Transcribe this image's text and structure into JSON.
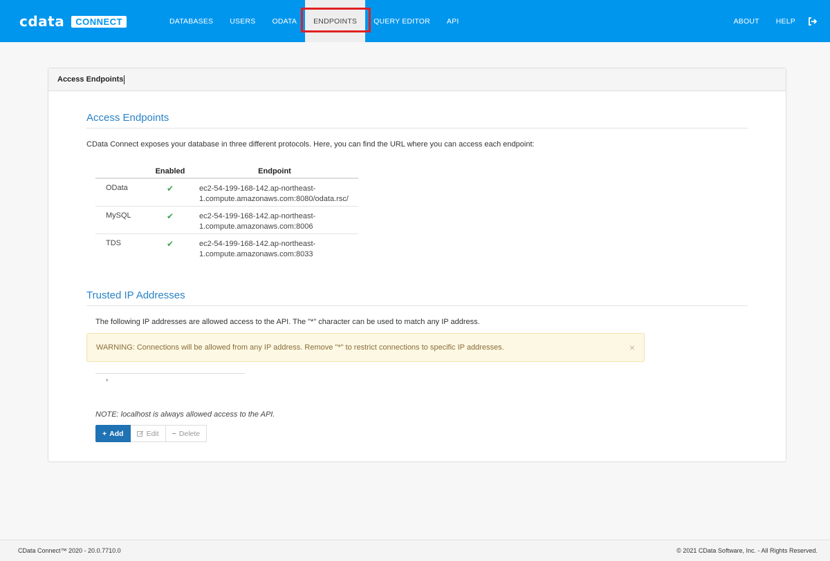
{
  "brand": {
    "name": "cdata",
    "product": "CONNECT"
  },
  "nav": {
    "items": [
      {
        "id": "databases",
        "label": "DATABASES"
      },
      {
        "id": "users",
        "label": "USERS"
      },
      {
        "id": "odata",
        "label": "ODATA"
      },
      {
        "id": "endpoints",
        "label": "ENDPOINTS"
      },
      {
        "id": "query-editor",
        "label": "QUERY EDITOR"
      },
      {
        "id": "api",
        "label": "API"
      }
    ],
    "right": {
      "about": "ABOUT",
      "help": "HELP",
      "signout_icon": "sign-out-icon"
    },
    "active": "ENDPOINTS"
  },
  "panel": {
    "header": "Access Endpoints"
  },
  "access": {
    "title": "Access Endpoints",
    "description": "CData Connect exposes your database in three different protocols. Here, you can find the URL where you can access each endpoint:",
    "table": {
      "headers": {
        "enabled": "Enabled",
        "endpoint": "Endpoint"
      },
      "rows": [
        {
          "name": "OData",
          "enabled": "✔",
          "url_line1": "ec2-54-199-168-142.ap-northeast-",
          "url_line2": "1.compute.amazonaws.com:8080/odata.rsc/"
        },
        {
          "name": "MySQL",
          "enabled": "✔",
          "url_line1": "ec2-54-199-168-142.ap-northeast-",
          "url_line2": "1.compute.amazonaws.com:8006"
        },
        {
          "name": "TDS",
          "enabled": "✔",
          "url_line1": "ec2-54-199-168-142.ap-northeast-",
          "url_line2": "1.compute.amazonaws.com:8033"
        }
      ]
    }
  },
  "trusted": {
    "title": "Trusted IP Addresses",
    "description": "The following IP addresses are allowed access to the API. The \"*\" character can be used to match any IP address.",
    "warning": "WARNING: Connections will be allowed from any IP address. Remove \"*\" to restrict connections to specific IP addresses.",
    "warning_close": "×",
    "ips": [
      "*"
    ],
    "note": "NOTE: localhost is always allowed access to the API.",
    "buttons": {
      "add": "Add",
      "edit": "Edit",
      "delete": "Delete"
    }
  },
  "footer": {
    "left": "CData Connect™ 2020 - 20.0.7710.0",
    "right": "© 2021 CData Software, Inc. - All Rights Reserved."
  },
  "colors": {
    "nav_bg": "#0096ee",
    "accent": "#2a82c6",
    "primary_button": "#1f72b3",
    "check": "#3fa34d",
    "warning_bg": "#fcf8e3",
    "highlight": "#e02020"
  }
}
